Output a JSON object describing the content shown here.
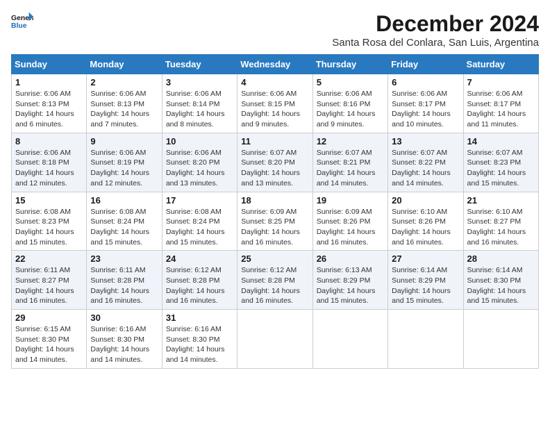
{
  "logo": {
    "line1": "General",
    "line2": "Blue"
  },
  "title": "December 2024",
  "subtitle": "Santa Rosa del Conlara, San Luis, Argentina",
  "days_of_week": [
    "Sunday",
    "Monday",
    "Tuesday",
    "Wednesday",
    "Thursday",
    "Friday",
    "Saturday"
  ],
  "weeks": [
    [
      {
        "day": "1",
        "sunrise": "6:06 AM",
        "sunset": "8:13 PM",
        "daylight": "14 hours and 6 minutes."
      },
      {
        "day": "2",
        "sunrise": "6:06 AM",
        "sunset": "8:13 PM",
        "daylight": "14 hours and 7 minutes."
      },
      {
        "day": "3",
        "sunrise": "6:06 AM",
        "sunset": "8:14 PM",
        "daylight": "14 hours and 8 minutes."
      },
      {
        "day": "4",
        "sunrise": "6:06 AM",
        "sunset": "8:15 PM",
        "daylight": "14 hours and 9 minutes."
      },
      {
        "day": "5",
        "sunrise": "6:06 AM",
        "sunset": "8:16 PM",
        "daylight": "14 hours and 9 minutes."
      },
      {
        "day": "6",
        "sunrise": "6:06 AM",
        "sunset": "8:17 PM",
        "daylight": "14 hours and 10 minutes."
      },
      {
        "day": "7",
        "sunrise": "6:06 AM",
        "sunset": "8:17 PM",
        "daylight": "14 hours and 11 minutes."
      }
    ],
    [
      {
        "day": "8",
        "sunrise": "6:06 AM",
        "sunset": "8:18 PM",
        "daylight": "14 hours and 12 minutes."
      },
      {
        "day": "9",
        "sunrise": "6:06 AM",
        "sunset": "8:19 PM",
        "daylight": "14 hours and 12 minutes."
      },
      {
        "day": "10",
        "sunrise": "6:06 AM",
        "sunset": "8:20 PM",
        "daylight": "14 hours and 13 minutes."
      },
      {
        "day": "11",
        "sunrise": "6:07 AM",
        "sunset": "8:20 PM",
        "daylight": "14 hours and 13 minutes."
      },
      {
        "day": "12",
        "sunrise": "6:07 AM",
        "sunset": "8:21 PM",
        "daylight": "14 hours and 14 minutes."
      },
      {
        "day": "13",
        "sunrise": "6:07 AM",
        "sunset": "8:22 PM",
        "daylight": "14 hours and 14 minutes."
      },
      {
        "day": "14",
        "sunrise": "6:07 AM",
        "sunset": "8:23 PM",
        "daylight": "14 hours and 15 minutes."
      }
    ],
    [
      {
        "day": "15",
        "sunrise": "6:08 AM",
        "sunset": "8:23 PM",
        "daylight": "14 hours and 15 minutes."
      },
      {
        "day": "16",
        "sunrise": "6:08 AM",
        "sunset": "8:24 PM",
        "daylight": "14 hours and 15 minutes."
      },
      {
        "day": "17",
        "sunrise": "6:08 AM",
        "sunset": "8:24 PM",
        "daylight": "14 hours and 15 minutes."
      },
      {
        "day": "18",
        "sunrise": "6:09 AM",
        "sunset": "8:25 PM",
        "daylight": "14 hours and 16 minutes."
      },
      {
        "day": "19",
        "sunrise": "6:09 AM",
        "sunset": "8:26 PM",
        "daylight": "14 hours and 16 minutes."
      },
      {
        "day": "20",
        "sunrise": "6:10 AM",
        "sunset": "8:26 PM",
        "daylight": "14 hours and 16 minutes."
      },
      {
        "day": "21",
        "sunrise": "6:10 AM",
        "sunset": "8:27 PM",
        "daylight": "14 hours and 16 minutes."
      }
    ],
    [
      {
        "day": "22",
        "sunrise": "6:11 AM",
        "sunset": "8:27 PM",
        "daylight": "14 hours and 16 minutes."
      },
      {
        "day": "23",
        "sunrise": "6:11 AM",
        "sunset": "8:28 PM",
        "daylight": "14 hours and 16 minutes."
      },
      {
        "day": "24",
        "sunrise": "6:12 AM",
        "sunset": "8:28 PM",
        "daylight": "14 hours and 16 minutes."
      },
      {
        "day": "25",
        "sunrise": "6:12 AM",
        "sunset": "8:28 PM",
        "daylight": "14 hours and 16 minutes."
      },
      {
        "day": "26",
        "sunrise": "6:13 AM",
        "sunset": "8:29 PM",
        "daylight": "14 hours and 15 minutes."
      },
      {
        "day": "27",
        "sunrise": "6:14 AM",
        "sunset": "8:29 PM",
        "daylight": "14 hours and 15 minutes."
      },
      {
        "day": "28",
        "sunrise": "6:14 AM",
        "sunset": "8:30 PM",
        "daylight": "14 hours and 15 minutes."
      }
    ],
    [
      {
        "day": "29",
        "sunrise": "6:15 AM",
        "sunset": "8:30 PM",
        "daylight": "14 hours and 14 minutes."
      },
      {
        "day": "30",
        "sunrise": "6:16 AM",
        "sunset": "8:30 PM",
        "daylight": "14 hours and 14 minutes."
      },
      {
        "day": "31",
        "sunrise": "6:16 AM",
        "sunset": "8:30 PM",
        "daylight": "14 hours and 14 minutes."
      },
      null,
      null,
      null,
      null
    ]
  ],
  "labels": {
    "sunrise": "Sunrise:",
    "sunset": "Sunset:",
    "daylight": "Daylight:"
  }
}
